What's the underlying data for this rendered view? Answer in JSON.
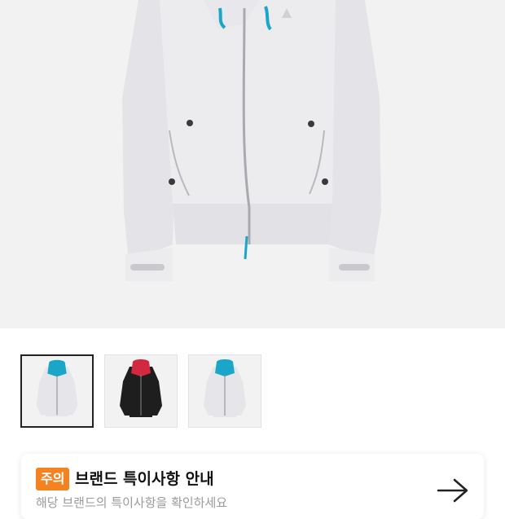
{
  "hero": {
    "image": "grey zip-up hoodie with blue drawstrings"
  },
  "thumbnails": [
    {
      "name": "thumbnail-grey-hoodie",
      "colors": {
        "body": "#e6e6ea",
        "hood": "#1aa6c8"
      },
      "selected": true
    },
    {
      "name": "thumbnail-black-hoodie",
      "colors": {
        "body": "#1e1e1e",
        "hood": "#d22840"
      },
      "selected": false
    },
    {
      "name": "thumbnail-grey-hoodie-alt",
      "colors": {
        "body": "#e6e6ea",
        "hood": "#1aa6c8"
      },
      "selected": false
    }
  ],
  "notice": {
    "badge": "주의",
    "title": "브랜드 특이사항 안내",
    "subtitle": "해당 브랜드의 특이사항을 확인하세요",
    "arrow_icon": "arrow-right-icon",
    "colors": {
      "badge": "#f58220"
    }
  }
}
